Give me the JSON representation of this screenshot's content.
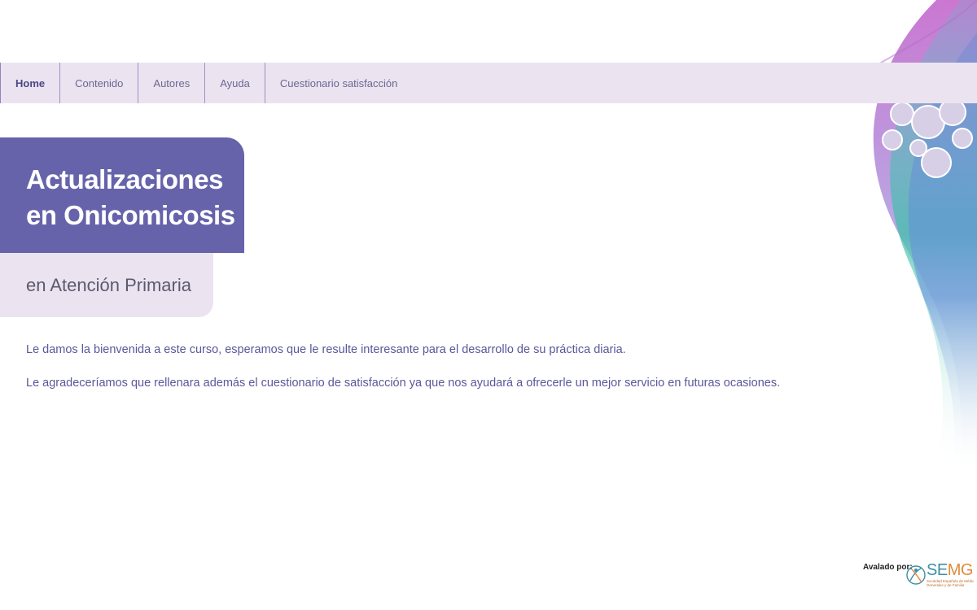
{
  "nav": {
    "items": [
      {
        "label": "Home",
        "active": true
      },
      {
        "label": "Contenido",
        "active": false
      },
      {
        "label": "Autores",
        "active": false
      },
      {
        "label": "Ayuda",
        "active": false
      },
      {
        "label": "Cuestionario satisfacción",
        "active": false
      }
    ]
  },
  "hero": {
    "title_line1": "Actualizaciones",
    "title_line2": "en Onicomicosis",
    "subtitle": "en Atención Primaria"
  },
  "intro": {
    "p1": "Le damos la bienvenida a este curso, esperamos que le resulte interesante para el desarrollo de su práctica diaria.",
    "p2": "Le agradeceríamos que rellenara además el cuestionario de satisfacción ya que nos ayudará a ofrecerle un mejor servicio en futuras ocasiones."
  },
  "endorsement": {
    "label": "Avalado por:",
    "logo_text_se": "SE",
    "logo_text_mg": "MG",
    "logo_sub_line1": "Sociedad Española de Médicos",
    "logo_sub_line2": "Generales y de Familia"
  },
  "colors": {
    "accent": "#6663ab",
    "nav_bg": "#ece3f1",
    "text": "#5a579a"
  }
}
